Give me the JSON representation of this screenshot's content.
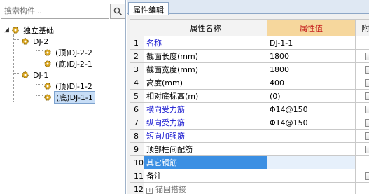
{
  "search": {
    "placeholder": "搜索构件..."
  },
  "tree": {
    "root": "独立基础",
    "groups": [
      {
        "label": "DJ-2",
        "children": [
          "(顶)DJ-2-2",
          "(底)DJ-2-1"
        ]
      },
      {
        "label": "DJ-1",
        "children": [
          "(顶)DJ-1-2",
          "(底)DJ-1-1"
        ]
      }
    ]
  },
  "tab": {
    "label": "属性编辑"
  },
  "grid": {
    "headers": {
      "name": "属性名称",
      "value": "属性值",
      "extra": "附加"
    },
    "rows": [
      {
        "num": "1",
        "name": "名称",
        "value": "DJ-1-1"
      },
      {
        "num": "2",
        "name": "截面长度(mm)",
        "value": "1800"
      },
      {
        "num": "3",
        "name": "截面宽度(mm)",
        "value": "1800"
      },
      {
        "num": "4",
        "name": "高度(mm)",
        "value": "400"
      },
      {
        "num": "5",
        "name": "相对底标高(m)",
        "value": "(0)"
      },
      {
        "num": "6",
        "name": "横向受力筋",
        "value": "Φ14@150"
      },
      {
        "num": "7",
        "name": "纵向受力筋",
        "value": "Φ14@150"
      },
      {
        "num": "8",
        "name": "短向加强筋",
        "value": ""
      },
      {
        "num": "9",
        "name": "顶部柱间配筋",
        "value": ""
      },
      {
        "num": "10",
        "name": "其它钢筋",
        "value": ""
      },
      {
        "num": "11",
        "name": "备注",
        "value": ""
      },
      {
        "num": "12",
        "name": "锚固搭接",
        "value": ""
      }
    ]
  },
  "colors": {
    "selected_row": "#3b8fe3",
    "value_header": "#f6d79d",
    "blue_text": "#1a1ad1"
  }
}
